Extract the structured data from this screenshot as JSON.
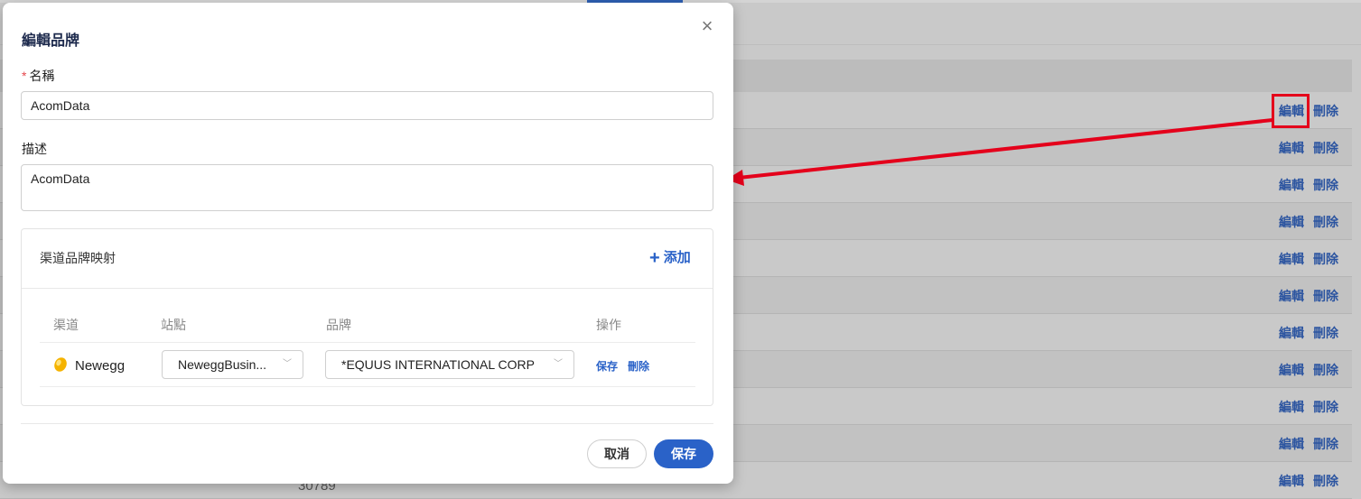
{
  "background": {
    "row_actions": [
      {
        "edit": "編輯",
        "delete": "刪除"
      },
      {
        "edit": "編輯",
        "delete": "刪除"
      },
      {
        "edit": "編輯",
        "delete": "刪除"
      },
      {
        "edit": "編輯",
        "delete": "刪除"
      },
      {
        "edit": "編輯",
        "delete": "刪除"
      },
      {
        "edit": "編輯",
        "delete": "刪除"
      },
      {
        "edit": "編輯",
        "delete": "刪除"
      },
      {
        "edit": "編輯",
        "delete": "刪除"
      },
      {
        "edit": "編輯",
        "delete": "刪除"
      },
      {
        "edit": "編輯",
        "delete": "刪除"
      },
      {
        "edit": "編輯",
        "delete": "刪除"
      }
    ],
    "partial_number": "30789"
  },
  "modal": {
    "title": "編輯品牌",
    "name_label": "名稱",
    "name_required_mark": "*",
    "name_value": "AcomData",
    "description_label": "描述",
    "description_value": "AcomData",
    "mapping": {
      "title": "渠道品牌映射",
      "add_label": "添加",
      "columns": [
        "渠道",
        "站點",
        "品牌",
        "操作"
      ],
      "rows": [
        {
          "channel": "Newegg",
          "site": "NeweggBusin...",
          "brand": "*EQUUS INTERNATIONAL CORP",
          "save": "保存",
          "delete": "刪除"
        }
      ]
    },
    "cancel_label": "取消",
    "save_label": "保存"
  },
  "colors": {
    "accent": "#2a62c8",
    "highlight": "#e4001b",
    "overlay": "#c9c9c9"
  }
}
